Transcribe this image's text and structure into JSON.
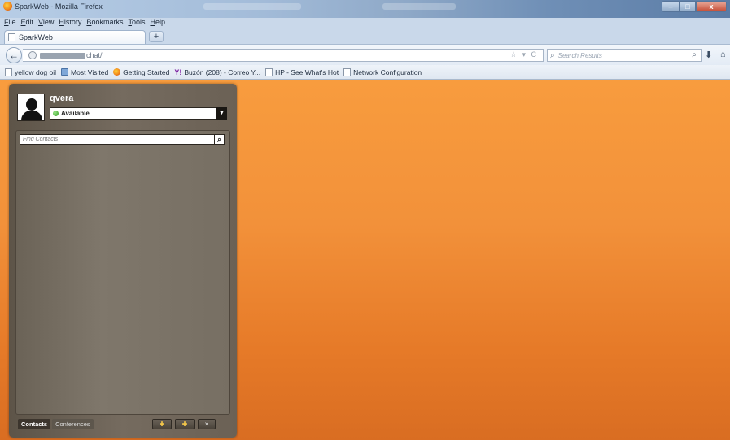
{
  "window": {
    "title": "SparkWeb - Mozilla Firefox",
    "controls": {
      "minimize": "–",
      "maximize": "□",
      "close": "x"
    }
  },
  "menu": [
    "File",
    "Edit",
    "View",
    "History",
    "Bookmarks",
    "Tools",
    "Help"
  ],
  "tabs": [
    {
      "label": "SparkWeb"
    }
  ],
  "new_tab_label": "+",
  "nav": {
    "back_glyph": "←",
    "url_path": "chat/",
    "url_actions": "☆ ▾ C",
    "search_engine_glyph": "⌕",
    "search_placeholder": "Search Results",
    "search_go_glyph": "⌕",
    "download_glyph": "⬇",
    "home_glyph": "⌂"
  },
  "bookmarks": [
    {
      "label": "yellow dog oil",
      "icon": "page-icon"
    },
    {
      "label": "Most Visited",
      "icon": "folder-icon"
    },
    {
      "label": "Getting Started",
      "icon": "firefox-icon"
    },
    {
      "label": "Buzón (208) - Correo Y...",
      "icon": "yahoo-icon",
      "glyph": "Y!"
    },
    {
      "label": "HP - See What's Hot",
      "icon": "page-icon"
    },
    {
      "label": "Network Configuration",
      "icon": "page-icon"
    }
  ],
  "spark": {
    "username": "qvera",
    "status": "Available",
    "status_dropdown_glyph": "▼",
    "find_placeholder": "Find Contacts",
    "find_button_glyph": "⌕",
    "bottom_tabs": [
      {
        "label": "Contacts"
      },
      {
        "label": "Conferences"
      }
    ],
    "tool_buttons": [
      {
        "name": "add-contact-button",
        "glyph": "✚"
      },
      {
        "name": "add-group-button",
        "glyph": "✚"
      },
      {
        "name": "remove-button",
        "glyph": "×"
      }
    ]
  },
  "colors": {
    "background_orange": "#f2913a",
    "panel_brown": "#756b5f",
    "status_green": "#2e9a1e"
  }
}
